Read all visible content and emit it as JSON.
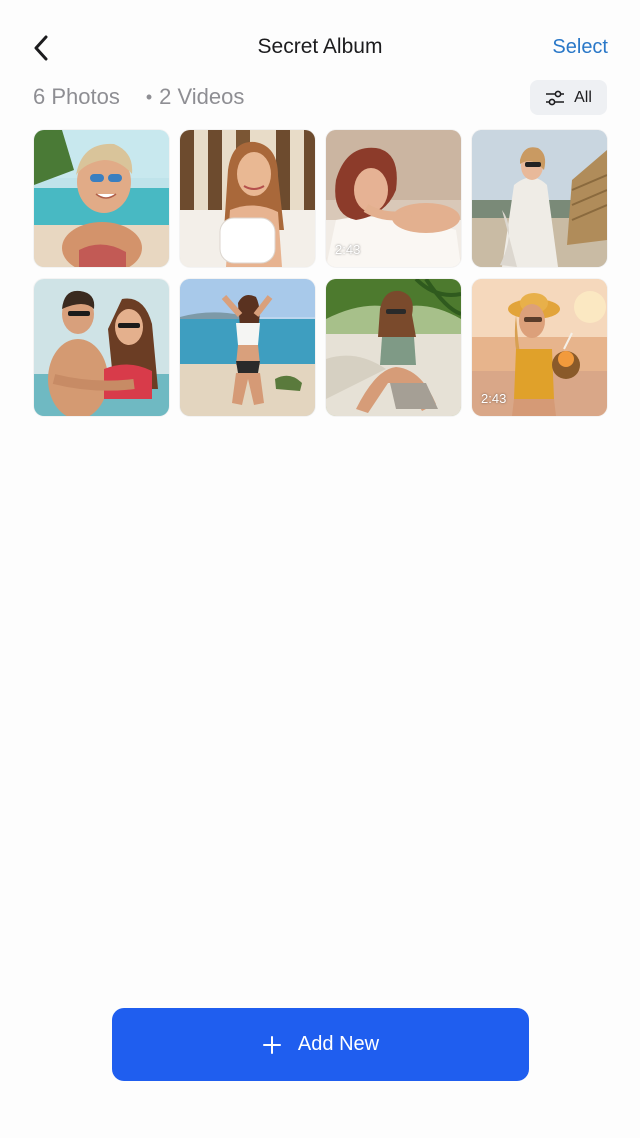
{
  "header": {
    "title": "Secret Album",
    "select_label": "Select",
    "back_icon": "chevron-left-icon"
  },
  "summary": {
    "photos_label": "6 Photos",
    "separator": "•",
    "videos_label": "2 Videos"
  },
  "filter": {
    "label": "All",
    "icon": "sliders-icon"
  },
  "media": [
    {
      "type": "photo",
      "subject": "woman with sunglasses on beach"
    },
    {
      "type": "photo",
      "subject": "woman holding pillow on bed"
    },
    {
      "type": "video",
      "subject": "woman lying on bed",
      "duration": "2:43"
    },
    {
      "type": "photo",
      "subject": "woman in white dress on beach"
    },
    {
      "type": "photo",
      "subject": "couple on beach"
    },
    {
      "type": "photo",
      "subject": "woman in bikini kneeling on beach"
    },
    {
      "type": "photo",
      "subject": "woman sitting on sand"
    },
    {
      "type": "video",
      "subject": "woman with coconut drink at sunset",
      "duration": "2:43"
    }
  ],
  "add_button": {
    "label": "Add New",
    "icon": "plus-icon"
  },
  "colors": {
    "accent": "#2a78c8",
    "button": "#1f5eef",
    "muted_text": "#8e8e93",
    "filter_bg": "#eef0f3"
  }
}
